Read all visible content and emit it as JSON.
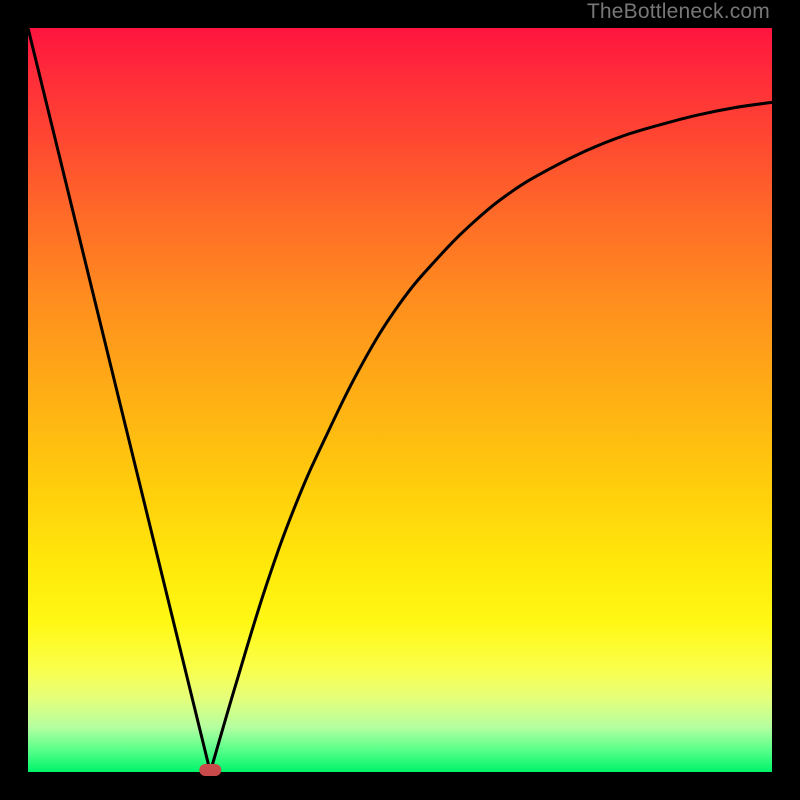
{
  "watermark": "TheBottleneck.com",
  "chart_data": {
    "type": "line",
    "title": "",
    "xlabel": "",
    "ylabel": "",
    "xlim": [
      0,
      100
    ],
    "ylim": [
      0,
      100
    ],
    "background": "vertical-gradient red→orange→yellow→green",
    "series": [
      {
        "name": "left-branch",
        "x": [
          0,
          24.5
        ],
        "y": [
          100,
          0
        ]
      },
      {
        "name": "right-curve",
        "x": [
          24.5,
          28,
          32,
          36,
          40,
          45,
          50,
          55,
          60,
          65,
          70,
          75,
          80,
          85,
          90,
          95,
          100
        ],
        "y": [
          0,
          12,
          25,
          36,
          45,
          55,
          63,
          69,
          74,
          78,
          81,
          83.5,
          85.5,
          87,
          88.3,
          89.3,
          90
        ]
      }
    ],
    "marker": {
      "name": "minimum-marker",
      "x": 24.5,
      "y": 0,
      "color": "#c84a4a",
      "shape": "rounded-rect"
    }
  }
}
